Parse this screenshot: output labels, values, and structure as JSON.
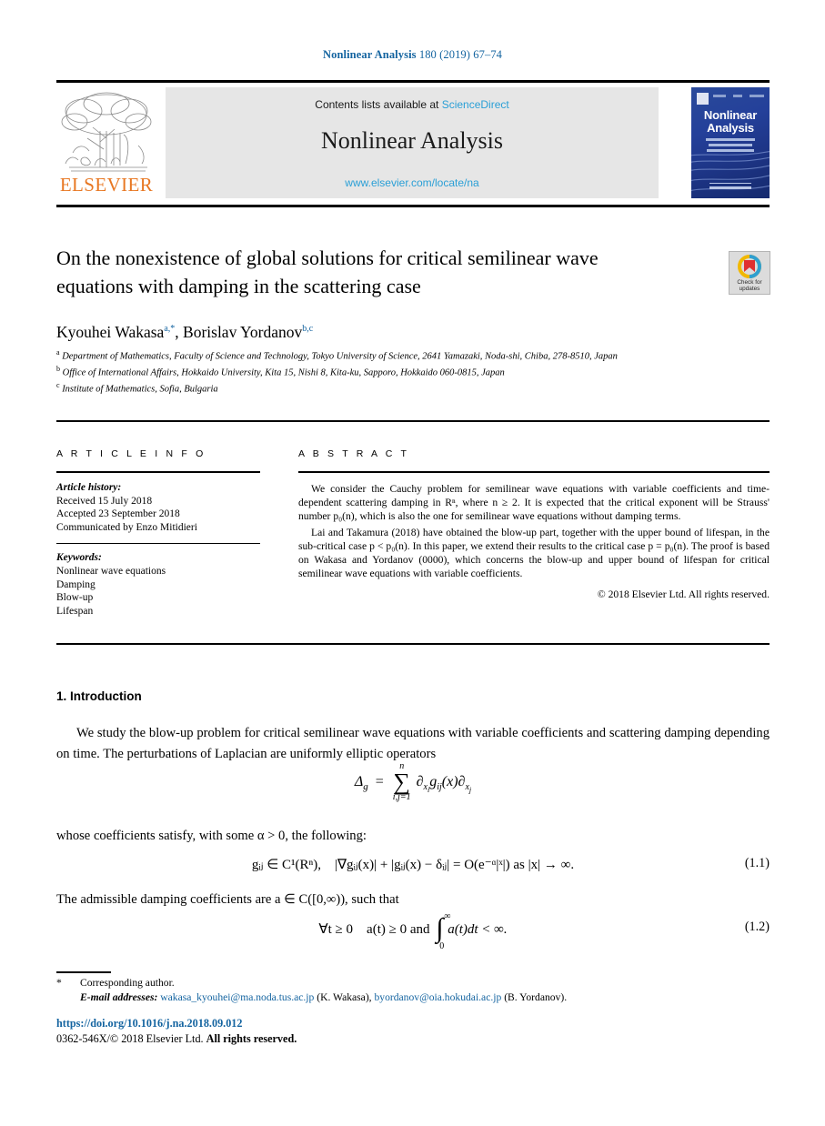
{
  "running_head": {
    "journal": "Nonlinear Analysis",
    "volume_info": "180 (2019) 67–74",
    "color": "#1464a0"
  },
  "masthead": {
    "contents_prefix": "Contents lists available at ",
    "sciencedirect": "ScienceDirect",
    "journal_title": "Nonlinear Analysis",
    "journal_url": "www.elsevier.com/locate/na",
    "publisher": "ELSEVIER",
    "cover_title": "Nonlinear\nAnalysis"
  },
  "crossmark": {
    "line1": "Check for",
    "line2": "updates"
  },
  "article": {
    "title": "On the nonexistence of global solutions for critical semilinear wave equations with damping in the scattering case",
    "authors_html": "Kyouhei Wakasa<sup>a,*</sup>, Borislav Yordanov<sup>b,c</sup>",
    "affiliations": [
      {
        "marker": "a",
        "text": "Department of Mathematics, Faculty of Science and Technology, Tokyo University of Science, 2641 Yamazaki, Noda-shi, Chiba, 278-8510, Japan"
      },
      {
        "marker": "b",
        "text": "Office of International Affairs, Hokkaido University, Kita 15, Nishi 8, Kita-ku, Sapporo, Hokkaido 060-0815, Japan"
      },
      {
        "marker": "c",
        "text": "Institute of Mathematics, Sofia, Bulgaria"
      }
    ]
  },
  "info": {
    "heading": "A R T I C L E   I N F O",
    "history_label": "Article history:",
    "history": [
      "Received 15 July 2018",
      "Accepted 23 September 2018",
      "Communicated by Enzo Mitidieri"
    ],
    "keywords_label": "Keywords:",
    "keywords": [
      "Nonlinear wave equations",
      "Damping",
      "Blow-up",
      "Lifespan"
    ]
  },
  "abstract": {
    "heading": "A B S T R A C T",
    "paragraph1": "We consider the Cauchy problem for semilinear wave equations with variable coefficients and time-dependent scattering damping in Rⁿ, where n ≥ 2. It is expected that the critical exponent will be Strauss' number p₀(n), which is also the one for semilinear wave equations without damping terms.",
    "paragraph2": "Lai and Takamura (2018) have obtained the blow-up part, together with the upper bound of lifespan, in the sub-critical case p < p₀(n). In this paper, we extend their results to the critical case p = p₀(n). The proof is based on Wakasa and Yordanov (0000), which concerns the blow-up and upper bound of lifespan for critical semilinear wave equations with variable coefficients.",
    "copyright": "© 2018 Elsevier Ltd. All rights reserved."
  },
  "body": {
    "section_heading": "1.  Introduction",
    "paragraph1": "We study the blow-up problem for critical semilinear wave equations with variable coefficients and scattering damping depending on time. The perturbations of Laplacian are uniformly elliptic operators",
    "paragraph2": "whose coefficients satisfy, with some α > 0, the following:",
    "paragraph3": "The admissible damping coefficients are a ∈ C([0,∞)), such that",
    "equations": {
      "eq0_lhs": "Δ",
      "eq0_sub": "g",
      "eq0_eq": "=",
      "eq0_sum_top": "n",
      "eq0_sum_bot": "i,j=1",
      "eq0_rhs": "∂",
      "eq1_text": "gᵢⱼ ∈ C¹(Rⁿ), |∇gᵢⱼ(x)| + |gᵢⱼ(x) − δᵢⱼ| = O(e⁻ᵅ|ˣ|) as |x| → ∞.",
      "eq1_number": "(1.1)",
      "eq2_text": "∀t ≥ 0 a(t) ≥ 0  and",
      "eq2_tail": "a(t)dt < ∞.",
      "eq2_int_top": "∞",
      "eq2_int_bot": "0",
      "eq2_number": "(1.2)"
    }
  },
  "footnotes": {
    "star": "*",
    "corresponding": "Corresponding author.",
    "email_label": "E-mail addresses:",
    "email1": "wakasa_kyouhei@ma.noda.tus.ac.jp",
    "email1_name": "(K. Wakasa),",
    "email2": "byordanov@oia.hokudai.ac.jp",
    "email2_name": "(B. Yordanov).",
    "doi": "https://doi.org/10.1016/j.na.2018.09.012",
    "issn_prefix": "0362-546X/",
    "issn_rest": "© 2018 Elsevier Ltd. ",
    "issn_bold": "All rights reserved."
  }
}
